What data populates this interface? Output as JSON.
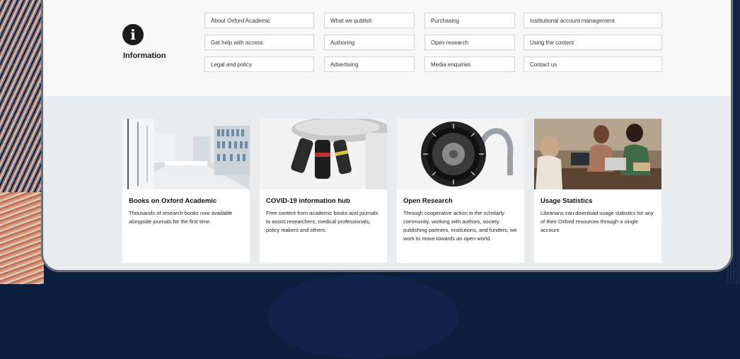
{
  "information": {
    "label": "Information",
    "links": [
      [
        "About Oxford Academic",
        "What we publish",
        "Purchasing",
        "Institutional account management"
      ],
      [
        "Get help with access",
        "Authoring",
        "Open research",
        "Using the content"
      ],
      [
        "Legal and policy",
        "Advertising",
        "Media enquiries",
        "Contact us"
      ]
    ]
  },
  "cards": [
    {
      "title": "Books on Oxford Academic",
      "desc": "Thousands of research books now available alongside journals for the first time."
    },
    {
      "title": "COVID-19 information hub",
      "desc": "Free content from academic books and journals to assist researchers, medical professionals, policy makers and others."
    },
    {
      "title": "Open Research",
      "desc": "Through cooperative action in the scholarly community, working with authors, society publishing partners, institutions, and funders, we work to move towards an open world."
    },
    {
      "title": "Usage Statistics",
      "desc": "Librarians can download usage statistics for any of their Oxford resources through a single account"
    }
  ]
}
